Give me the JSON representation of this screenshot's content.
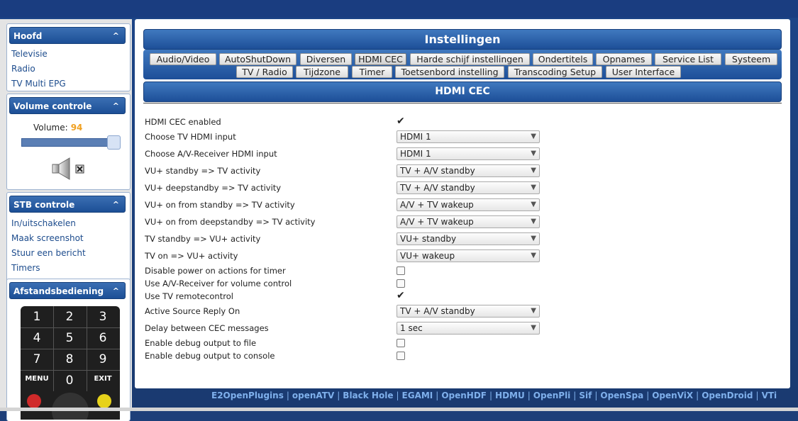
{
  "sidebar": {
    "hoofd": {
      "title": "Hoofd",
      "links": [
        "Televisie",
        "Radio",
        "TV Multi EPG"
      ]
    },
    "volume": {
      "title": "Volume controle",
      "label": "Volume:",
      "value": "94",
      "level": 0.94
    },
    "stb": {
      "title": "STB controle",
      "links": [
        "In/uitschakelen",
        "Maak screenshot",
        "Stuur een bericht",
        "Timers"
      ]
    },
    "remote": {
      "title": "Afstandsbediening",
      "keys": [
        "1",
        "2",
        "3",
        "4",
        "5",
        "6",
        "7",
        "8",
        "9",
        "MENU",
        "0",
        "EXIT"
      ]
    },
    "collapse_glyph": "^"
  },
  "main": {
    "title": "Instellingen",
    "tabs_row1": [
      "Audio/Video",
      "AutoShutDown",
      "Diversen",
      "HDMI CEC",
      "Harde schijf instellingen",
      "Ondertitels",
      "Opnames",
      "Service List",
      "Systeem"
    ],
    "tabs_row2": [
      "TV / Radio",
      "Tijdzone",
      "Timer",
      "Toetsenbord instelling",
      "Transcoding Setup",
      "User Interface"
    ],
    "active_tab": "HDMI CEC",
    "section_title": "HDMI CEC",
    "settings": [
      {
        "label": "HDMI CEC enabled",
        "type": "checkbox",
        "checked": true
      },
      {
        "label": "Choose TV HDMI input",
        "type": "select",
        "value": "HDMI 1"
      },
      {
        "label": "Choose A/V-Receiver HDMI input",
        "type": "select",
        "value": "HDMI 1"
      },
      {
        "label": "VU+ standby => TV activity",
        "type": "select",
        "value": "TV + A/V standby"
      },
      {
        "label": "VU+ deepstandby => TV activity",
        "type": "select",
        "value": "TV + A/V standby"
      },
      {
        "label": "VU+ on from standby => TV activity",
        "type": "select",
        "value": "A/V + TV wakeup"
      },
      {
        "label": "VU+ on from deepstandby => TV activity",
        "type": "select",
        "value": "A/V + TV wakeup"
      },
      {
        "label": "TV standby => VU+ activity",
        "type": "select",
        "value": "VU+ standby"
      },
      {
        "label": "TV on => VU+ activity",
        "type": "select",
        "value": "VU+ wakeup"
      },
      {
        "label": "Disable power on actions for timer",
        "type": "checkbox",
        "checked": false
      },
      {
        "label": "Use A/V-Receiver for volume control",
        "type": "checkbox",
        "checked": false
      },
      {
        "label": "Use TV remotecontrol",
        "type": "checkbox",
        "checked": true
      },
      {
        "label": "Active Source Reply On",
        "type": "select",
        "value": "TV + A/V standby"
      },
      {
        "label": "Delay between CEC messages",
        "type": "select",
        "value": "1 sec"
      },
      {
        "label": "Enable debug output to file",
        "type": "checkbox",
        "checked": false
      },
      {
        "label": "Enable debug output to console",
        "type": "checkbox",
        "checked": false
      }
    ]
  },
  "footer": {
    "links": [
      "E2OpenPlugins",
      "openATV",
      "Black Hole",
      "EGAMI",
      "OpenHDF",
      "HDMU",
      "OpenPli",
      "Sif",
      "OpenSpa",
      "OpenViX",
      "OpenDroid",
      "VTi"
    ],
    "separator": "|"
  },
  "colors": {
    "accent": "#1d4f98",
    "volume_number": "#f0a020",
    "link": "#1d4c8d",
    "footer_link": "#7fb0ec"
  },
  "icons": [
    "chevron-up-icon",
    "speaker-icon",
    "mute-icon",
    "checkmark-icon",
    "dropdown-arrow-icon"
  ]
}
